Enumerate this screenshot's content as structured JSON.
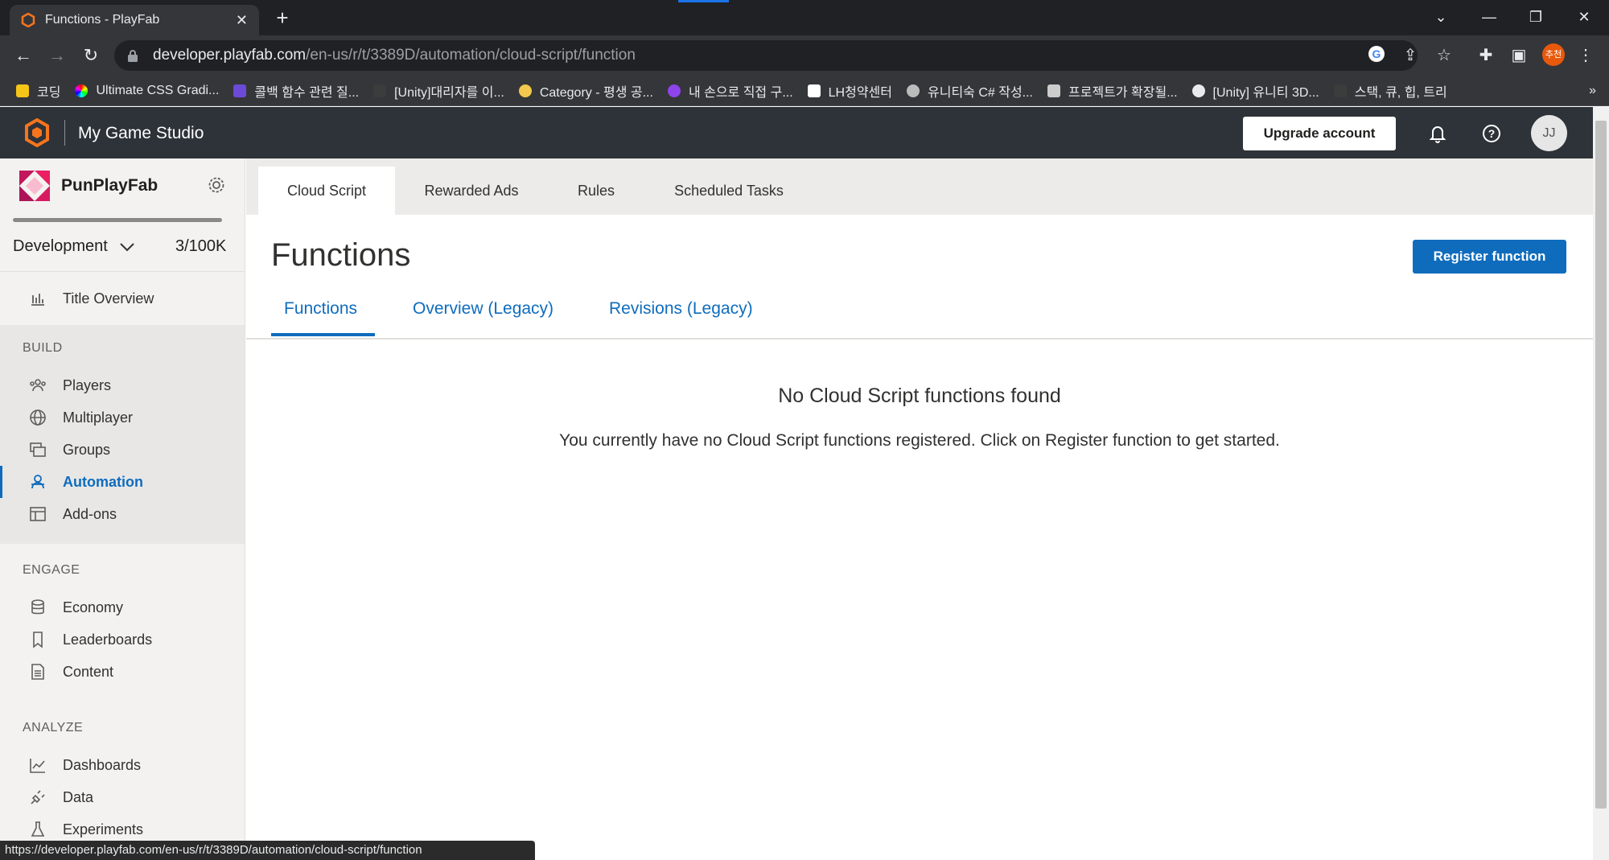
{
  "browser": {
    "tab_title": "Functions - PlayFab",
    "tab_close": "✕",
    "new_tab": "+",
    "url_host": "developer.playfab.com",
    "url_path": "/en-us/r/t/3389D/automation/cloud-script/function",
    "profile_label": "추천",
    "bookmarks": [
      {
        "label": "코딩",
        "color": "#f5c518"
      },
      {
        "label": "Ultimate CSS Gradi...",
        "color": "#c04cff"
      },
      {
        "label": "콜백 함수 관련 질...",
        "color": "#6c4ad8"
      },
      {
        "label": "[Unity]대리자를 이...",
        "color": "#3c3c3c"
      },
      {
        "label": "Category - 평생 공...",
        "color": "#f2c94c"
      },
      {
        "label": "내 손으로 직접 구...",
        "color": "#8e44ec"
      },
      {
        "label": "LH청약센터",
        "color": "#ffffff"
      },
      {
        "label": "유니티숙 C# 작성...",
        "color": "#bbbbbb"
      },
      {
        "label": "프로젝트가 확장될...",
        "color": "#cccccc"
      },
      {
        "label": "[Unity] 유니티 3D...",
        "color": "#e8eaed"
      },
      {
        "label": "스택, 큐, 힙, 트리",
        "color": "#3c3c3c"
      }
    ],
    "bookmarks_more": "»",
    "status_url": "https://developer.playfab.com/en-us/r/t/3389D/automation/cloud-script/function"
  },
  "header": {
    "studio": "My Game Studio",
    "upgrade_label": "Upgrade account",
    "avatar_initials": "JJ",
    "accent": "#f7741d"
  },
  "sidebar": {
    "title_name": "PunPlayFab",
    "environment": "Development",
    "usage": "3/100K",
    "overview": "Title Overview",
    "build_label": "BUILD",
    "build_items": [
      "Players",
      "Multiplayer",
      "Groups",
      "Automation",
      "Add-ons"
    ],
    "engage_label": "ENGAGE",
    "engage_items": [
      "Economy",
      "Leaderboards",
      "Content"
    ],
    "analyze_label": "ANALYZE",
    "analyze_items": [
      "Dashboards",
      "Data",
      "Experiments"
    ]
  },
  "main": {
    "top_tabs": [
      "Cloud Script",
      "Rewarded Ads",
      "Rules",
      "Scheduled Tasks"
    ],
    "page_title": "Functions",
    "register_label": "Register function",
    "sub_tabs": [
      "Functions",
      "Overview (Legacy)",
      "Revisions (Legacy)"
    ],
    "empty_title": "No Cloud Script functions found",
    "empty_text": "You currently have no Cloud Script functions registered. Click on Register function to get started."
  },
  "colors": {
    "primary": "#0f6cbd",
    "header_bg": "#2d3339"
  }
}
